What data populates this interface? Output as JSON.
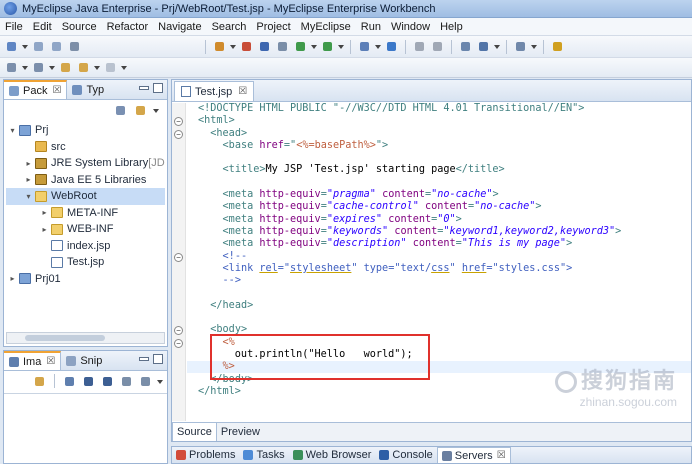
{
  "window": {
    "title": "MyEclipse Java Enterprise - Prj/WebRoot/Test.jsp - MyEclipse Enterprise Workbench"
  },
  "menu": [
    "File",
    "Edit",
    "Source",
    "Refactor",
    "Navigate",
    "Search",
    "Project",
    "MyEclipse",
    "Run",
    "Window",
    "Help"
  ],
  "package_view": {
    "tabs": [
      {
        "label": "Pack",
        "close": "☒"
      },
      {
        "label": "Typ"
      }
    ],
    "tree": [
      {
        "label": "Prj",
        "twisty": "▾",
        "icon": "project-icon",
        "depth": 0
      },
      {
        "label": "src",
        "twisty": "",
        "icon": "source-folder-icon",
        "depth": 1
      },
      {
        "label": "JRE System Library",
        "suffix": "[JD",
        "twisty": "▸",
        "icon": "library-icon",
        "depth": 1
      },
      {
        "label": "Java EE 5 Libraries",
        "twisty": "▸",
        "icon": "library-icon",
        "depth": 1
      },
      {
        "label": "WebRoot",
        "twisty": "▾",
        "icon": "folder-icon",
        "depth": 1,
        "selected": true
      },
      {
        "label": "META-INF",
        "twisty": "▸",
        "icon": "folder-icon",
        "depth": 2
      },
      {
        "label": "WEB-INF",
        "twisty": "▸",
        "icon": "folder-icon",
        "depth": 2
      },
      {
        "label": "index.jsp",
        "twisty": "",
        "icon": "jsp-file-icon",
        "depth": 2
      },
      {
        "label": "Test.jsp",
        "twisty": "",
        "icon": "jsp-file-icon",
        "depth": 2
      },
      {
        "label": "Prj01",
        "twisty": "▸",
        "icon": "project-icon",
        "depth": 0
      }
    ]
  },
  "image_view": {
    "tabs": [
      {
        "label": "Ima",
        "close": "☒"
      },
      {
        "label": "Snip"
      }
    ]
  },
  "editor": {
    "tab": {
      "label": "Test.jsp",
      "close": "☒"
    },
    "bottom_tabs": [
      "Source",
      "Preview"
    ],
    "lines": [
      [
        [
          "tag",
          "<!DOCTYPE HTML PUBLIC \"-//W3C//DTD HTML 4.01 Transitional//EN\">"
        ]
      ],
      [
        [
          "tag",
          "<html>"
        ]
      ],
      [
        [
          "txt",
          "  "
        ],
        [
          "tag",
          "<head>"
        ]
      ],
      [
        [
          "txt",
          "    "
        ],
        [
          "tag",
          "<base "
        ],
        [
          "attr",
          "href"
        ],
        [
          "tag",
          "=\""
        ],
        [
          "jsp",
          "<%=basePath%>"
        ],
        [
          "tag",
          "\">"
        ]
      ],
      [
        [
          "txt",
          ""
        ]
      ],
      [
        [
          "txt",
          "    "
        ],
        [
          "tag",
          "<title>"
        ],
        [
          "txt",
          "My JSP 'Test.jsp' starting page"
        ],
        [
          "tag",
          "</title>"
        ]
      ],
      [
        [
          "txt",
          ""
        ]
      ],
      [
        [
          "txt",
          "    "
        ],
        [
          "tag",
          "<meta "
        ],
        [
          "attr",
          "http-equiv"
        ],
        [
          "tag",
          "="
        ],
        [
          "val",
          "\"pragma\""
        ],
        [
          "tag",
          " "
        ],
        [
          "attr",
          "content"
        ],
        [
          "tag",
          "="
        ],
        [
          "val",
          "\"no-cache\""
        ],
        [
          "tag",
          ">"
        ]
      ],
      [
        [
          "txt",
          "    "
        ],
        [
          "tag",
          "<meta "
        ],
        [
          "attr",
          "http-equiv"
        ],
        [
          "tag",
          "="
        ],
        [
          "val",
          "\"cache-control\""
        ],
        [
          "tag",
          " "
        ],
        [
          "attr",
          "content"
        ],
        [
          "tag",
          "="
        ],
        [
          "val",
          "\"no-cache\""
        ],
        [
          "tag",
          ">"
        ]
      ],
      [
        [
          "txt",
          "    "
        ],
        [
          "tag",
          "<meta "
        ],
        [
          "attr",
          "http-equiv"
        ],
        [
          "tag",
          "="
        ],
        [
          "val",
          "\"expires\""
        ],
        [
          "tag",
          " "
        ],
        [
          "attr",
          "content"
        ],
        [
          "tag",
          "="
        ],
        [
          "val",
          "\"0\""
        ],
        [
          "tag",
          ">"
        ]
      ],
      [
        [
          "txt",
          "    "
        ],
        [
          "tag",
          "<meta "
        ],
        [
          "attr",
          "http-equiv"
        ],
        [
          "tag",
          "="
        ],
        [
          "val",
          "\"keywords\""
        ],
        [
          "tag",
          " "
        ],
        [
          "attr",
          "content"
        ],
        [
          "tag",
          "="
        ],
        [
          "val",
          "\"keyword1,keyword2,keyword3\""
        ],
        [
          "tag",
          ">"
        ]
      ],
      [
        [
          "txt",
          "    "
        ],
        [
          "tag",
          "<meta "
        ],
        [
          "attr",
          "http-equiv"
        ],
        [
          "tag",
          "="
        ],
        [
          "val",
          "\"description\""
        ],
        [
          "tag",
          " "
        ],
        [
          "attr",
          "content"
        ],
        [
          "tag",
          "="
        ],
        [
          "val",
          "\"This is my page\""
        ],
        [
          "tag",
          ">"
        ]
      ],
      [
        [
          "txt",
          "    "
        ],
        [
          "com",
          "<!--"
        ]
      ],
      [
        [
          "txt",
          "    "
        ],
        [
          "com",
          "<link "
        ],
        [
          "comul",
          "rel"
        ],
        [
          "com",
          "=\""
        ],
        [
          "comul",
          "stylesheet"
        ],
        [
          "com",
          "\" type=\"text/"
        ],
        [
          "comul",
          "css"
        ],
        [
          "com",
          "\" "
        ],
        [
          "comul",
          "href"
        ],
        [
          "com",
          "=\"styles.css\">"
        ]
      ],
      [
        [
          "txt",
          "    "
        ],
        [
          "com",
          "-->"
        ]
      ],
      [
        [
          "txt",
          ""
        ]
      ],
      [
        [
          "txt",
          "  "
        ],
        [
          "tag",
          "</head>"
        ]
      ],
      [
        [
          "txt",
          ""
        ]
      ],
      [
        [
          "txt",
          "  "
        ],
        [
          "tag",
          "<body>"
        ]
      ],
      [
        [
          "txt",
          "    "
        ],
        [
          "jsp",
          "<%"
        ]
      ],
      [
        [
          "txt",
          "      out.println(\"Hello   world\");"
        ]
      ],
      [
        [
          "txt",
          "    "
        ],
        [
          "jsp",
          "%>"
        ]
      ],
      [
        [
          "txt",
          "  "
        ],
        [
          "tag",
          "</body>"
        ]
      ],
      [
        [
          "tag",
          "</html>"
        ]
      ]
    ],
    "fold_lines": [
      1,
      2,
      12,
      18,
      19
    ]
  },
  "bottom_views": [
    {
      "label": "Problems",
      "color": "#d24b3a"
    },
    {
      "label": "Tasks",
      "color": "#4e8bd6"
    },
    {
      "label": "Web Browser",
      "color": "#3a8f5a"
    },
    {
      "label": "Console",
      "color": "#2e5fa6"
    },
    {
      "label": "Servers",
      "color": "#6a7fa0",
      "active": true,
      "close": "☒"
    }
  ],
  "watermark": {
    "brand": "搜狗指南",
    "url": "zhinan.sogou.com"
  },
  "colors": {
    "accent_tab": "#f0a334",
    "highlight_box": "#e0312c",
    "selected_row": "#c7dcf6"
  }
}
